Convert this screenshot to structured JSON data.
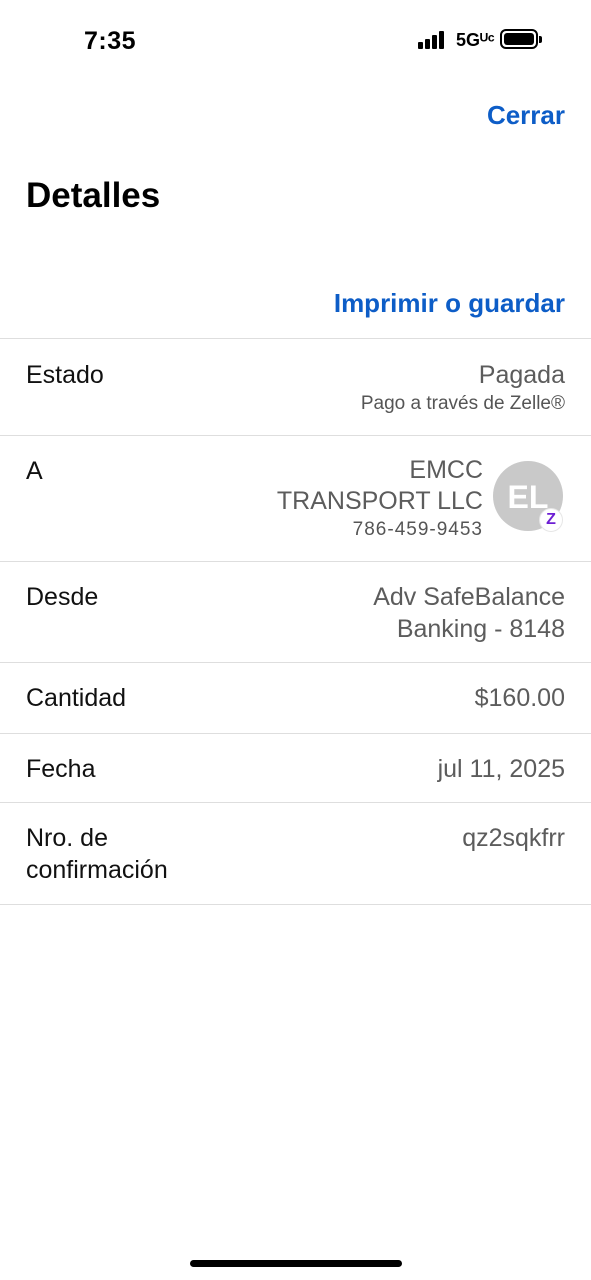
{
  "status_bar": {
    "time": "7:35",
    "network": "5Gᵁᶜ",
    "icons": [
      "signal-icon",
      "battery-icon"
    ]
  },
  "header": {
    "close_label": "Cerrar",
    "title": "Detalles",
    "print_label": "Imprimir o guardar"
  },
  "details": {
    "status": {
      "label": "Estado",
      "value": "Pagada",
      "sub": "Pago a través de Zelle®"
    },
    "recipient": {
      "label": "A",
      "name_line1": "EMCC",
      "name_line2": "TRANSPORT LLC",
      "phone": "786-459-9453",
      "initials": "EL",
      "badge": "Z"
    },
    "from": {
      "label": "Desde",
      "value_line1": "Adv SafeBalance",
      "value_line2": "Banking - 8148"
    },
    "amount": {
      "label": "Cantidad",
      "value": "$160.00"
    },
    "date": {
      "label": "Fecha",
      "value": "jul 11, 2025"
    },
    "confirmation": {
      "label_line1": "Nro. de",
      "label_line2": "confirmación",
      "value": "qz2sqkfrr"
    }
  },
  "colors": {
    "accent": "#0d5dc7",
    "zelle": "#6d1ed4",
    "divider": "#dedede"
  }
}
